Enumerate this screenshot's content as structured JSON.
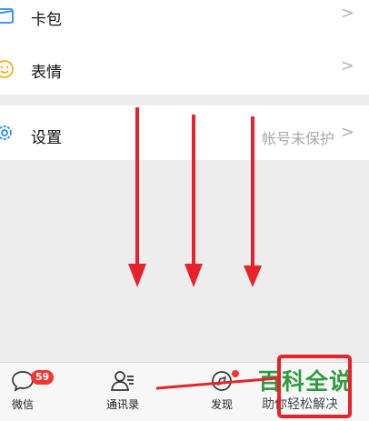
{
  "menu": {
    "wallet_label": "卡包",
    "sticker_label": "表情",
    "settings_label": "设置",
    "settings_status": "帐号未保护",
    "chevron": ">"
  },
  "tabbar": {
    "chats_label": "微信",
    "chats_badge": "59",
    "contacts_label": "通讯录",
    "discover_label": "发现"
  },
  "watermark": {
    "title": "百科全说",
    "subtitle": "助你轻松解决"
  },
  "colors": {
    "accent": "#2c89f2",
    "sticker": "#f2b21b",
    "badge": "#f43530",
    "annotation": "#e8222a",
    "watermark": "#2e9b3e"
  }
}
